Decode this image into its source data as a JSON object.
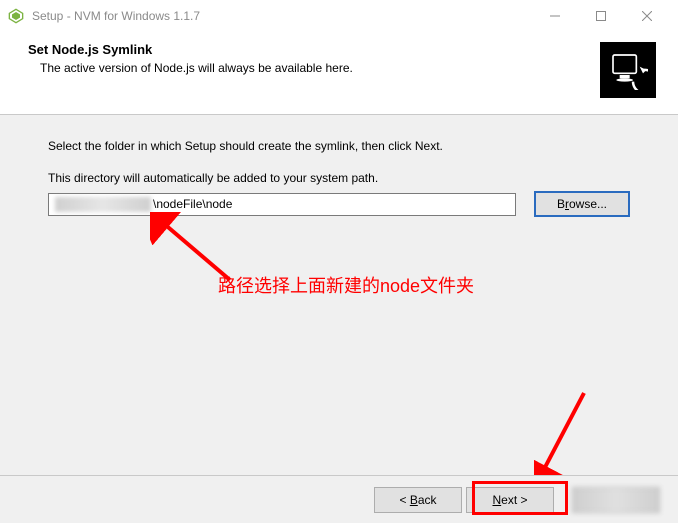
{
  "window": {
    "title": "Setup - NVM for Windows 1.1.7"
  },
  "header": {
    "title": "Set Node.js Symlink",
    "subtitle": "The active version of Node.js will always be available here."
  },
  "content": {
    "instruction": "Select the folder in which Setup should create the symlink, then click Next.",
    "path_label": "This directory will automatically be added to your system path.",
    "path_value": "\\nodeFile\\node",
    "browse_label": "Browse..."
  },
  "annotations": {
    "note1": "路径选择上面新建的node文件夹"
  },
  "footer": {
    "back_label": "< Back",
    "next_label": "Next >"
  }
}
